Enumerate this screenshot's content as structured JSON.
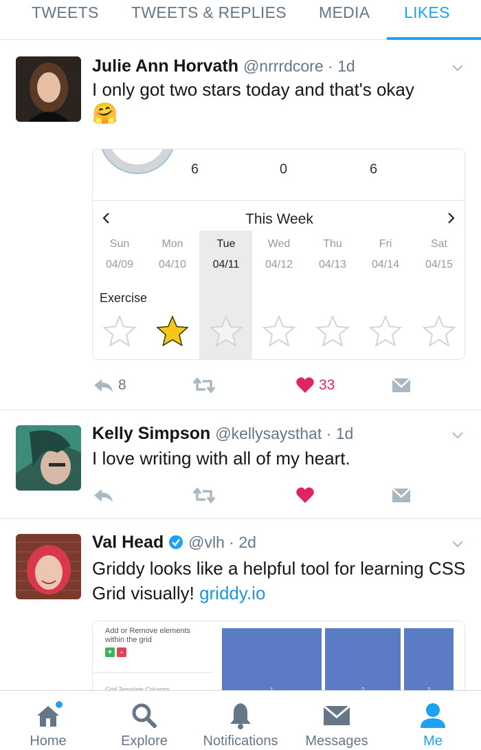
{
  "tabs": [
    {
      "label": "TWEETS"
    },
    {
      "label": "TWEETS & REPLIES"
    },
    {
      "label": "MEDIA"
    },
    {
      "label": "LIKES",
      "active": true
    }
  ],
  "tweets": [
    {
      "name": "Julie Ann Horvath",
      "handle": "@nrrrdcore",
      "time": "1d",
      "text": "I only got two stars today and that's okay",
      "emoji": "🤗",
      "avatar": "avatar-woman-dark-hair",
      "card": {
        "stats": [
          "6",
          "0",
          "6"
        ],
        "week_title": "This Week",
        "days": [
          {
            "name": "Sun",
            "date": "04/09"
          },
          {
            "name": "Mon",
            "date": "04/10"
          },
          {
            "name": "Tue",
            "date": "04/11"
          },
          {
            "name": "Wed",
            "date": "04/12"
          },
          {
            "name": "Thu",
            "date": "04/13"
          },
          {
            "name": "Fri",
            "date": "04/14"
          },
          {
            "name": "Sat",
            "date": "04/15"
          }
        ],
        "row_label": "Exercise",
        "selected_day_index": 2,
        "filled_star_index": 1
      },
      "replies": "8",
      "likes": "33",
      "liked": true
    },
    {
      "name": "Kelly Simpson",
      "handle": "@kellysaysthat",
      "time": "1d",
      "text": "I love writing with all of my heart.",
      "avatar": "avatar-woman-teal-hair",
      "liked": true
    },
    {
      "name": "Val Head",
      "verified": true,
      "handle": "@vlh",
      "time": "2d",
      "text": "Griddy looks like a helpful tool for learning CSS Grid visually!",
      "link": "griddy.io",
      "avatar": "avatar-woman-red-hair",
      "card": {
        "label": "Add or Remove elements within the grid",
        "add_symbol": "+",
        "remove_symbol": "-",
        "faint_label": "Grid Template Columns",
        "grid_numbers": [
          "1",
          "2",
          "3"
        ]
      }
    }
  ],
  "bottom_nav": [
    {
      "label": "Home",
      "icon": "home-icon",
      "badge": true
    },
    {
      "label": "Explore",
      "icon": "search-icon"
    },
    {
      "label": "Notifications",
      "icon": "bell-icon"
    },
    {
      "label": "Messages",
      "icon": "envelope-icon"
    },
    {
      "label": "Me",
      "icon": "person-icon",
      "active": true
    }
  ],
  "colors": {
    "accent": "#1da1f2",
    "like": "#e0245e",
    "grid_blue": "#5b7bc4",
    "star_gold": "#f5c518"
  }
}
